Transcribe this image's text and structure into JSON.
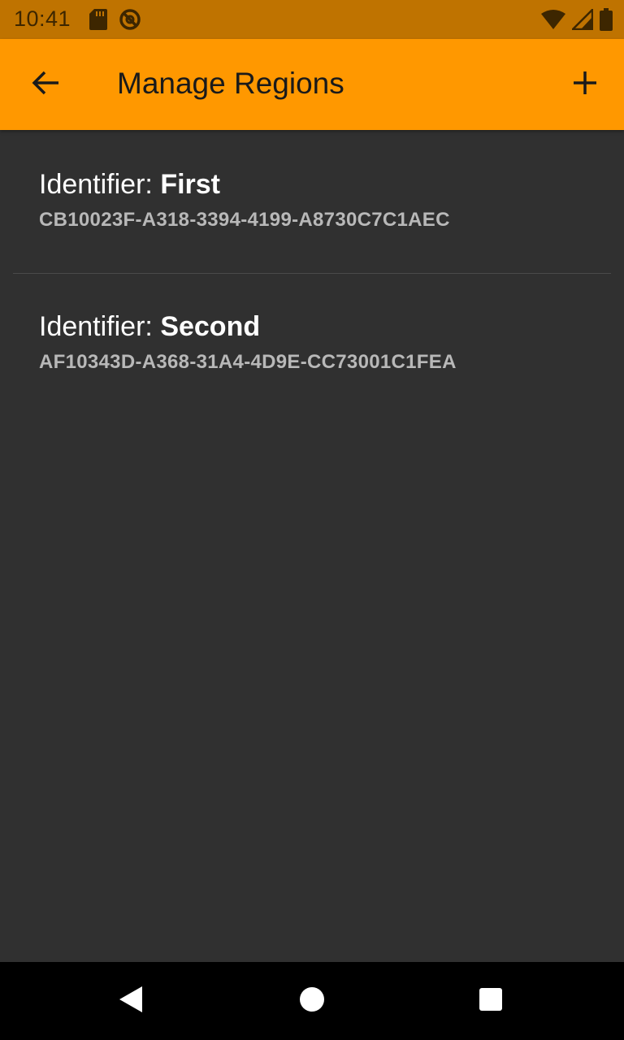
{
  "status_bar": {
    "time": "10:41",
    "left_icons": [
      "sd-card-icon",
      "do-not-disturb-icon"
    ],
    "right_icons": [
      "wifi-icon",
      "signal-icon",
      "battery-icon"
    ],
    "color": "#bf7300"
  },
  "app_bar": {
    "title": "Manage Regions",
    "back_icon": "arrow-back-icon",
    "add_icon": "plus-icon",
    "color": "#ff9800"
  },
  "regions": [
    {
      "label": "Identifier: ",
      "name": "First",
      "uuid": "CB10023F-A318-3394-4199-A8730C7C1AEC"
    },
    {
      "label": "Identifier: ",
      "name": "Second",
      "uuid": "AF10343D-A368-31A4-4D9E-CC73001C1FEA"
    }
  ],
  "nav_bar": {
    "buttons": [
      "back-triangle-icon",
      "home-circle-icon",
      "recents-square-icon"
    ]
  },
  "colors": {
    "background": "#303030",
    "accent": "#ff9800",
    "uuid_text": "#b8b8b8"
  }
}
